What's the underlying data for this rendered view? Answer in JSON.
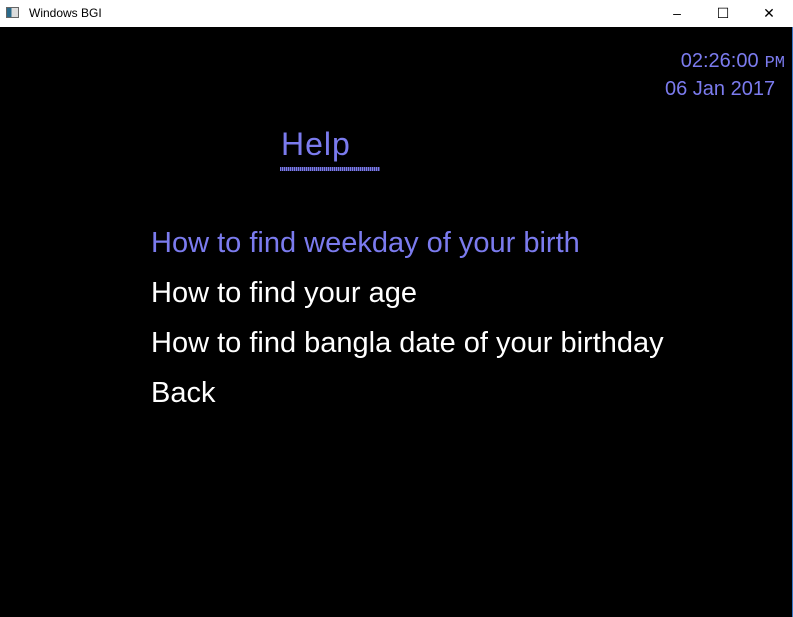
{
  "window": {
    "title": "Windows BGI",
    "minimize": "–",
    "maximize": "☐",
    "close": "✕"
  },
  "clock": {
    "time": "02:26:00",
    "ampm": "PM",
    "date": "06 Jan 2017"
  },
  "heading": "Help",
  "menu": {
    "items": [
      {
        "label": "How to find weekday of your birth",
        "selected": true
      },
      {
        "label": "How to find your age",
        "selected": false
      },
      {
        "label": "How to find bangla date of your birthday",
        "selected": false
      },
      {
        "label": "Back",
        "selected": false
      }
    ]
  },
  "colors": {
    "accent": "#7b7bee",
    "text": "#ffffff",
    "background": "#000000"
  }
}
